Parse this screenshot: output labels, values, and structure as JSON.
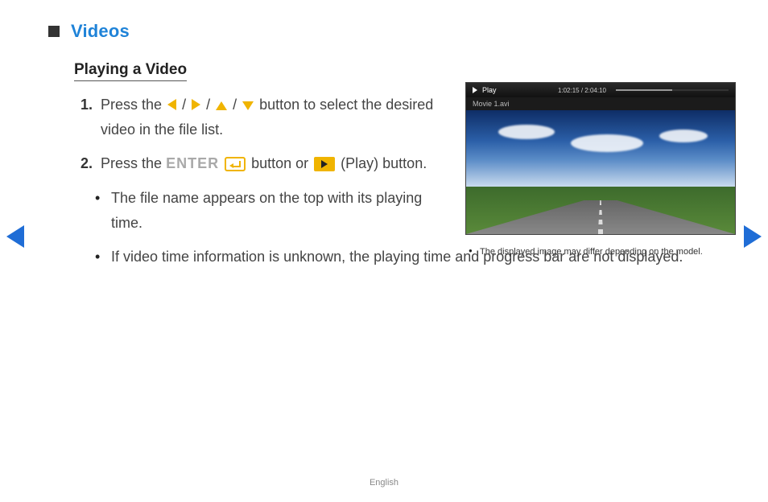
{
  "header": {
    "title": "Videos"
  },
  "subheading": "Playing a Video",
  "steps": {
    "s1_num": "1.",
    "s1_a": "Press the ",
    "s1_b": " button to select the desired video in the file list.",
    "slash": " / ",
    "s2_num": "2.",
    "s2_a": "Press the ",
    "enter_label": "ENTER",
    "s2_b": " button or ",
    "s2_c": " (Play) button."
  },
  "bullets": {
    "b1": "The file name appears on the top with its playing time.",
    "b2": "If video time information is unknown, the playing time and progress bar are not displayed."
  },
  "player": {
    "status": "Play",
    "time": "1:02:15 / 2:04:10",
    "filename": "Movie 1.avi"
  },
  "caption": "The displayed image may differ depending on the model.",
  "footer": {
    "language": "English"
  }
}
